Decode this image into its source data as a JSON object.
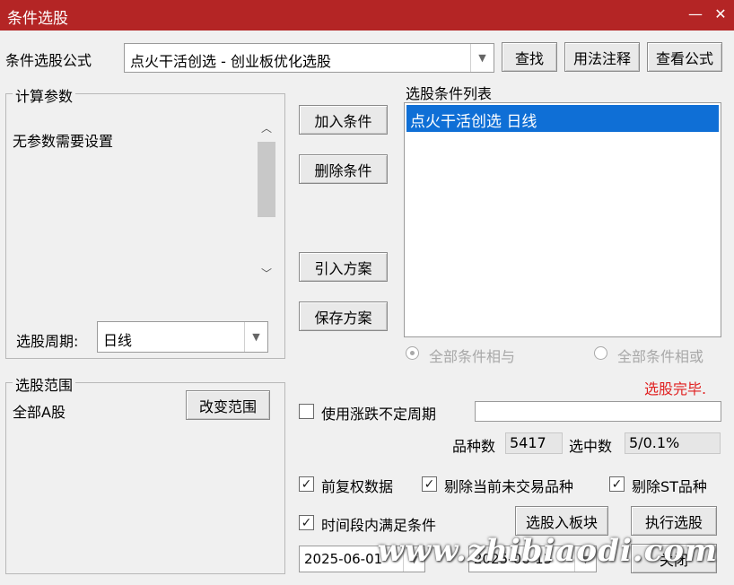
{
  "window": {
    "title": "条件选股"
  },
  "formula": {
    "label": "条件选股公式",
    "selected": "点火干活创选  -  创业板优化选股",
    "find_btn": "查找",
    "usage_btn": "用法注释",
    "view_btn": "查看公式"
  },
  "params": {
    "legend": "计算参数",
    "text": "无参数需要设置",
    "period_label": "选股周期:",
    "period_value": "日线"
  },
  "middle_buttons": {
    "add": "加入条件",
    "delete": "删除条件",
    "import": "引入方案",
    "save": "保存方案"
  },
  "conditions": {
    "label": "选股条件列表",
    "items": [
      "点火干活创选  日线"
    ],
    "radio_and": "全部条件相与",
    "radio_or": "全部条件相或",
    "status": "选股完毕."
  },
  "range": {
    "legend": "选股范围",
    "value": "全部A股",
    "change_btn": "改变范围"
  },
  "options": {
    "variable_period": "使用涨跌不定周期",
    "variety_count_label": "品种数",
    "variety_count": "5417",
    "selected_label": "选中数",
    "selected_value": "5/0.1%",
    "pre_adjust": "前复权数据",
    "remove_untraded": "剔除当前未交易品种",
    "remove_st": "剔除ST品种",
    "time_segment": "时间段内满足条件"
  },
  "actions": {
    "to_block": "选股入板块",
    "execute": "执行选股",
    "close": "关闭",
    "date_from": "2025-06-01",
    "date_to": "2025-06-13"
  },
  "watermark": "www.zhibiaodi.com",
  "colors": {
    "title_bg": "#b42525",
    "selection": "#0f6fd6",
    "status": "#e02020"
  }
}
